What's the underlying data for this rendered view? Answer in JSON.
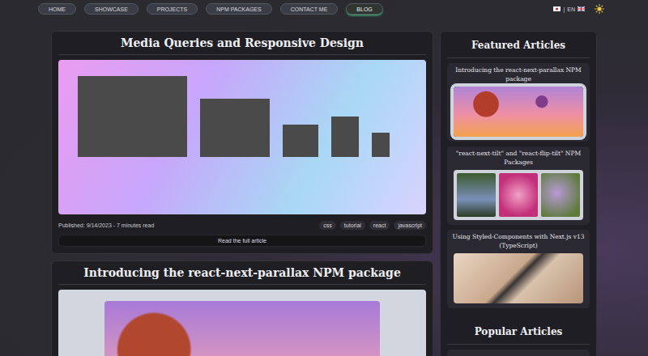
{
  "nav": {
    "items": [
      {
        "label": "HOME",
        "selected": false
      },
      {
        "label": "SHOWCASE",
        "selected": false
      },
      {
        "label": "PROJECTS",
        "selected": false
      },
      {
        "label": "NPM PACKAGES",
        "selected": false
      },
      {
        "label": "CONTACT ME",
        "selected": false
      },
      {
        "label": "BLOG",
        "selected": true
      }
    ],
    "language": {
      "label": "EN",
      "separator": "|"
    }
  },
  "articles": [
    {
      "title": "Media Queries and Responsive Design",
      "published": "Published: 9/14/2023 - 7 minutes read",
      "tags": [
        "css",
        "tutorial",
        "react",
        "javascript"
      ],
      "button": "Read the full article"
    },
    {
      "title": "Introducing the react-next-parallax NPM package"
    }
  ],
  "featured": {
    "heading": "Featured Articles",
    "items": [
      {
        "title": "Introducing the react-next-parallax NPM package"
      },
      {
        "title": "\"react-next-tilt\" and \"react-flip-tilt\" NPM Packages"
      },
      {
        "title": "Using Styled-Components with Next.js v13 (TypeScript)"
      }
    ]
  },
  "popular": {
    "heading": "Popular Articles"
  }
}
